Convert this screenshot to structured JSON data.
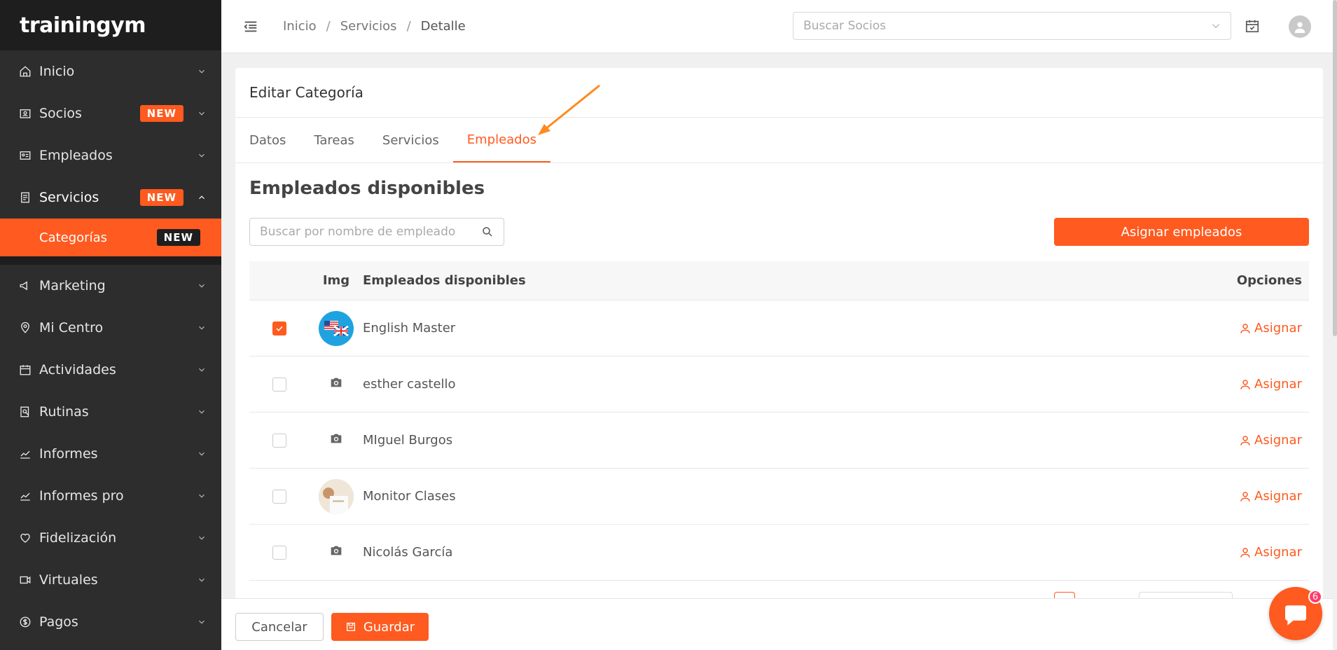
{
  "app": {
    "logo_text": "trainingym"
  },
  "sidebar": {
    "items": [
      {
        "label": "Inicio",
        "icon": "home-icon"
      },
      {
        "label": "Socios",
        "icon": "id-card-icon",
        "badge": "NEW"
      },
      {
        "label": "Empleados",
        "icon": "badge-card-icon"
      },
      {
        "label": "Servicios",
        "icon": "clipboard-icon",
        "badge": "NEW"
      },
      {
        "label": "Marketing",
        "icon": "megaphone-icon"
      },
      {
        "label": "Mi Centro",
        "icon": "location-pin-icon"
      },
      {
        "label": "Actividades",
        "icon": "calendar-icon"
      },
      {
        "label": "Rutinas",
        "icon": "routine-icon"
      },
      {
        "label": "Informes",
        "icon": "chart-line-icon"
      },
      {
        "label": "Informes pro",
        "icon": "chart-line-icon"
      },
      {
        "label": "Fidelización",
        "icon": "heart-icon"
      },
      {
        "label": "Virtuales",
        "icon": "video-icon"
      },
      {
        "label": "Pagos",
        "icon": "dollar-icon"
      }
    ],
    "sub_active": {
      "label": "Categorías",
      "badge": "NEW"
    }
  },
  "topbar": {
    "breadcrumb": [
      "Inicio",
      "Servicios",
      "Detalle"
    ],
    "search_placeholder": "Buscar Socios"
  },
  "card": {
    "title": "Editar Categoría",
    "tabs": [
      "Datos",
      "Tareas",
      "Servicios",
      "Empleados"
    ],
    "active_tab": "Empleados",
    "section_title": "Empleados disponibles",
    "search_placeholder": "Buscar por nombre de empleado",
    "assign_button": "Asignar empleados",
    "table": {
      "headers": {
        "img": "Img",
        "name": "Empleados disponibles",
        "options": "Opciones"
      },
      "rows": [
        {
          "name": "English Master",
          "checked": true,
          "avatar": "flag",
          "action": "Asignar"
        },
        {
          "name": "esther castello",
          "checked": false,
          "avatar": "camera",
          "action": "Asignar"
        },
        {
          "name": "MIguel Burgos",
          "checked": false,
          "avatar": "camera",
          "action": "Asignar"
        },
        {
          "name": "Monitor Clases",
          "checked": false,
          "avatar": "photo",
          "action": "Asignar"
        },
        {
          "name": "Nicolás García",
          "checked": false,
          "avatar": "camera",
          "action": "Asignar"
        }
      ]
    }
  },
  "footer": {
    "cancel": "Cancelar",
    "save": "Guardar"
  },
  "chat": {
    "badge": "6"
  },
  "colors": {
    "accent": "#ff5a1f",
    "sidebar_bg": "#2d2d2d",
    "sidebar_header_bg": "#1e1e1e"
  }
}
